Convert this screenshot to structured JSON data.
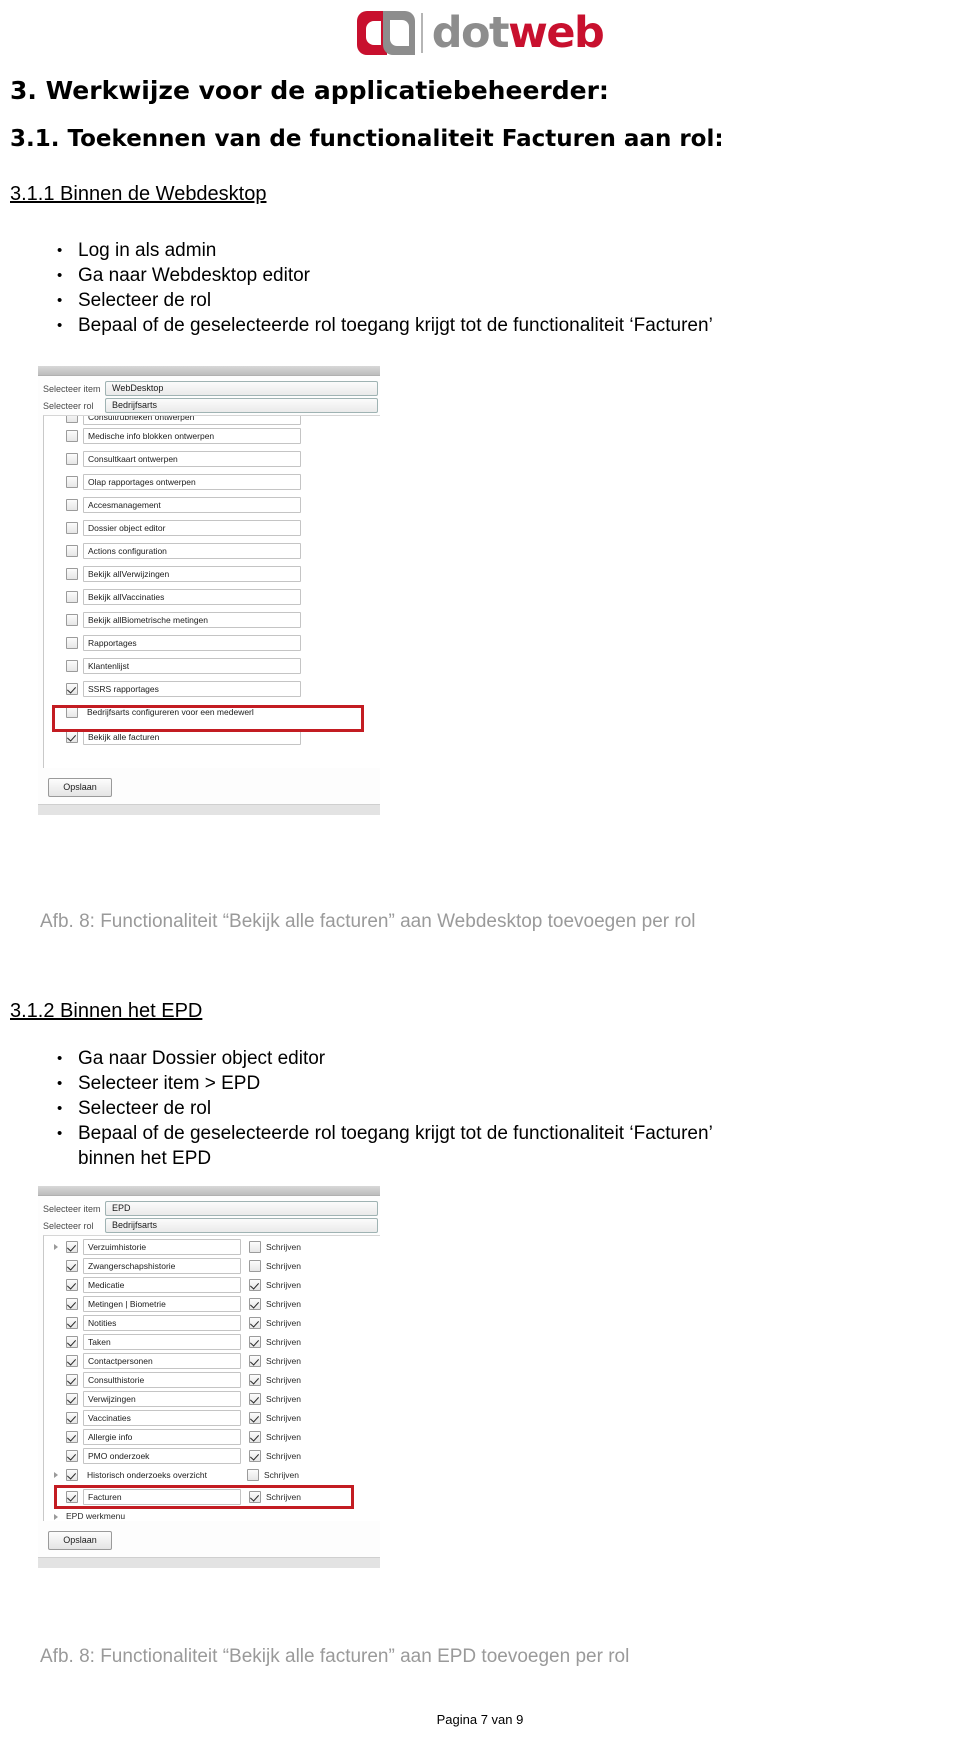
{
  "logo": {
    "alt": "dotweb",
    "text_dot": "dot",
    "text_web": "web",
    "color_red": "#c8102e",
    "color_gray": "#8d8d8d"
  },
  "headings": {
    "h1": "3. Werkwijze voor de applicatiebeheerder:",
    "h2": "3.1. Toekennen van de functionaliteit Facturen aan rol:",
    "h3_webdesktop": "3.1.1 Binnen de Webdesktop",
    "h3_epd": "3.1.2 Binnen het EPD"
  },
  "bullets_webdesktop": [
    "Log in als admin",
    "Ga naar Webdesktop editor",
    "Selecteer de rol",
    "Bepaal of de geselecteerde rol toegang krijgt tot de functionaliteit ‘Facturen’"
  ],
  "bullets_epd": [
    "Ga naar Dossier object editor",
    "Selecteer item > EPD",
    "Selecteer de rol",
    "Bepaal of de geselecteerde rol toegang krijgt tot de functionaliteit ‘Facturen’",
    "binnen het EPD"
  ],
  "screenshot_webdesktop": {
    "select_item_label": "Selecteer item",
    "select_item_value": "WebDesktop",
    "select_role_label": "Selecteer rol",
    "select_role_value": "Bedrijfsarts",
    "save_button": "Opslaan",
    "highlight_color": "#c31c22",
    "rows": [
      {
        "label": "Consultrubrieken  ontwerpen",
        "checked": false,
        "clipped": true
      },
      {
        "label": "Medische  info  blokken  ontwerpen",
        "checked": false
      },
      {
        "label": "Consultkaart  ontwerpen",
        "checked": false
      },
      {
        "label": "Olap  rapportages  ontwerpen",
        "checked": false
      },
      {
        "label": "Accesmanagement",
        "checked": false
      },
      {
        "label": "Dossier  object  editor",
        "checked": false
      },
      {
        "label": "Actions  configuration",
        "checked": false
      },
      {
        "label": "Bekijk  allVerwijzingen",
        "checked": false
      },
      {
        "label": "Bekijk  allVaccinaties",
        "checked": false
      },
      {
        "label": "Bekijk  allBiometrische  metingen",
        "checked": false
      },
      {
        "label": "Rapportages",
        "checked": false
      },
      {
        "label": "Klantenlijst",
        "checked": false
      },
      {
        "label": "SSRS  rapportages",
        "checked": true
      },
      {
        "label": "Bedrijfsarts  configureren  voor  een  medewerl",
        "checked": false,
        "nobox": true
      },
      {
        "label": "Bekijk alle facturen",
        "checked": true,
        "highlighted": true
      }
    ]
  },
  "caption_webdesktop": "Afb. 8: Functionaliteit “Bekijk alle facturen” aan Webdesktop toevoegen per rol",
  "screenshot_epd": {
    "select_item_label": "Selecteer item",
    "select_item_value": "EPD",
    "select_role_label": "Selecteer rol",
    "select_role_value": "Bedrijfsarts",
    "write_label": "Schrijven",
    "save_button": "Opslaan",
    "tree_leaf": "EPD werkmenu",
    "highlight_color": "#c31c22",
    "rows": [
      {
        "label": "Verzuimhistorie",
        "checked": true,
        "write": false,
        "expandable": true
      },
      {
        "label": "Zwangerschapshistorie",
        "checked": true,
        "write": false
      },
      {
        "label": "Medicatie",
        "checked": true,
        "write": true
      },
      {
        "label": "Metingen | Biometrie",
        "checked": true,
        "write": true
      },
      {
        "label": "Notities",
        "checked": true,
        "write": true
      },
      {
        "label": "Taken",
        "checked": true,
        "write": true
      },
      {
        "label": "Contactpersonen",
        "checked": true,
        "write": true
      },
      {
        "label": "Consulthistorie",
        "checked": true,
        "write": true
      },
      {
        "label": "Verwijzingen",
        "checked": true,
        "write": true
      },
      {
        "label": "Vaccinaties",
        "checked": true,
        "write": true
      },
      {
        "label": "Allergie info",
        "checked": true,
        "write": true
      },
      {
        "label": "PMO onderzoek",
        "checked": true,
        "write": true
      },
      {
        "label": "Historisch onderzoeks overzicht",
        "checked": true,
        "write": false,
        "expandable": true
      },
      {
        "label": "Facturen",
        "checked": true,
        "write": true,
        "highlighted": true
      }
    ]
  },
  "caption_epd": "Afb. 8: Functionaliteit “Bekijk alle facturen” aan EPD  toevoegen per rol",
  "footer": "Pagina 7 van 9"
}
